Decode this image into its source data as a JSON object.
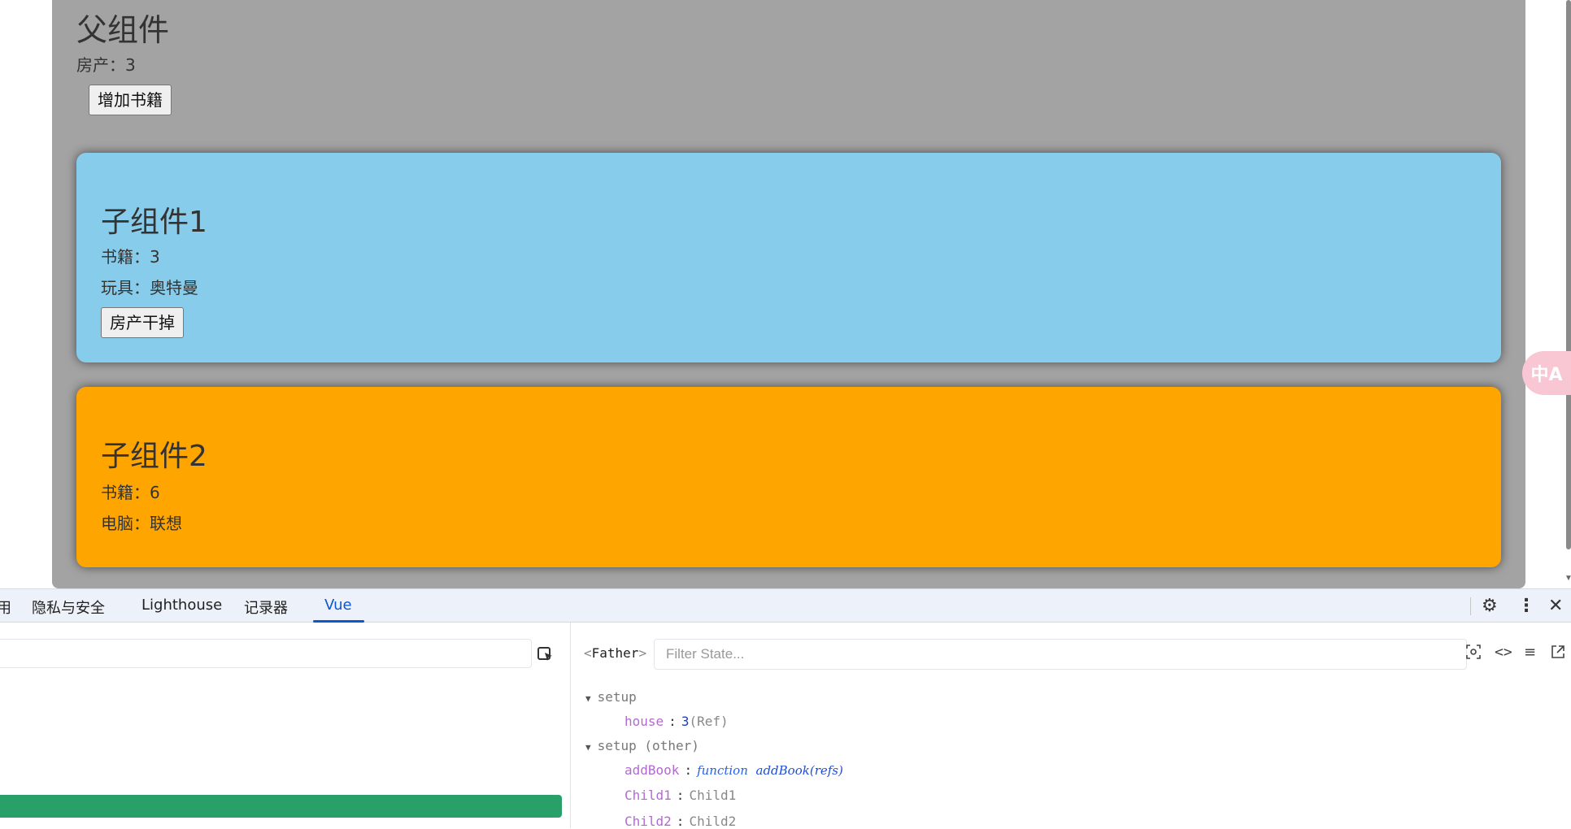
{
  "page": {
    "father": {
      "title": "父组件",
      "house_line": "房产：3",
      "add_book_button": "增加书籍"
    },
    "child1": {
      "title": "子组件1",
      "books_line": "书籍：3",
      "toy_line": "玩具：奥特曼",
      "button": "房产干掉",
      "background": "#87ceeb"
    },
    "child2": {
      "title": "子组件2",
      "books_line": "书籍：6",
      "computer_line": "电脑：联想",
      "background": "#ffa500"
    },
    "father_background": "#a3a3a3",
    "translate_icon": "中A"
  },
  "devtools": {
    "tabs": [
      {
        "label": "用"
      },
      {
        "label": "隐私与安全"
      },
      {
        "label": "Lighthouse"
      },
      {
        "label": "记录器"
      },
      {
        "label": "Vue",
        "active": true
      }
    ],
    "toolbar_icons": [
      "gear-icon",
      "more-vert-icon",
      "close-icon"
    ],
    "inspector": {
      "component_name": "Father",
      "filter_placeholder": "Filter State...",
      "sections": [
        {
          "title": "setup",
          "items": [
            {
              "key": "house",
              "value": "3",
              "meta": "(Ref)"
            }
          ]
        },
        {
          "title": "setup (other)",
          "items": [
            {
              "key": "addBook",
              "value_kw": "function",
              "value": "addBook(refs)"
            },
            {
              "key": "Child1",
              "value": "Child1"
            },
            {
              "key": "Child2",
              "value": "Child2"
            }
          ]
        }
      ]
    },
    "accent": "#2aa069"
  }
}
